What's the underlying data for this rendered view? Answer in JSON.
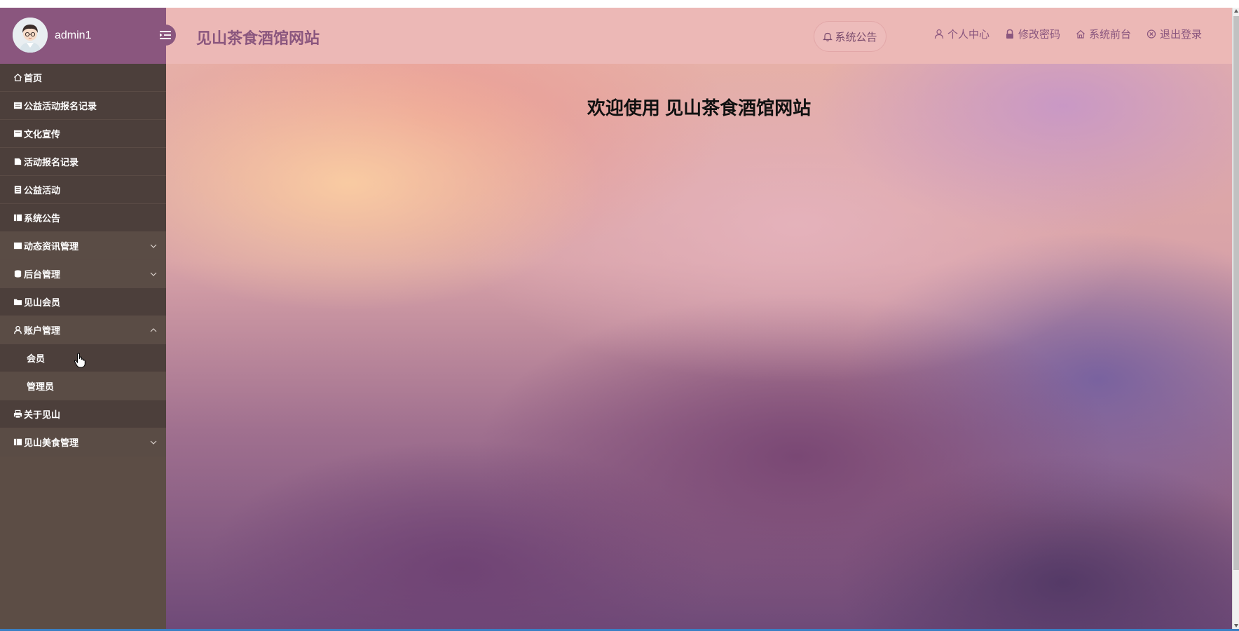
{
  "sidebar": {
    "username": "admin1",
    "items": [
      {
        "label": "首页",
        "icon": "home-icon"
      },
      {
        "label": "公益活动报名记录",
        "icon": "list-icon"
      },
      {
        "label": "文化宣传",
        "icon": "list-icon"
      },
      {
        "label": "活动报名记录",
        "icon": "doc-icon"
      },
      {
        "label": "公益活动",
        "icon": "doc-icon"
      },
      {
        "label": "系统公告",
        "icon": "list-icon"
      },
      {
        "label": "动态资讯管理",
        "icon": "list-icon",
        "expanded": false
      },
      {
        "label": "后台管理",
        "icon": "db-icon",
        "expanded": false
      },
      {
        "label": "见山会员",
        "icon": "folder-icon"
      },
      {
        "label": "账户管理",
        "icon": "user-icon",
        "expanded": true
      },
      {
        "label": "会员",
        "sub": true
      },
      {
        "label": "管理员",
        "sub": true
      },
      {
        "label": "关于见山",
        "icon": "printer-icon"
      },
      {
        "label": "见山美食管理",
        "icon": "list-icon",
        "expanded": false
      }
    ]
  },
  "header": {
    "title": "见山茶食酒馆网站",
    "notice_label": "系统公告",
    "links": {
      "profile": "个人中心",
      "password": "修改密码",
      "frontend": "系统前台",
      "logout": "退出登录"
    }
  },
  "main": {
    "welcome": "欢迎使用 见山茶食酒馆网站"
  },
  "colors": {
    "sidebar_bg": "#5c4d45",
    "sidebar_head": "#8a567e",
    "header_bg": "#ecb8b6",
    "accent": "#8a567e"
  }
}
